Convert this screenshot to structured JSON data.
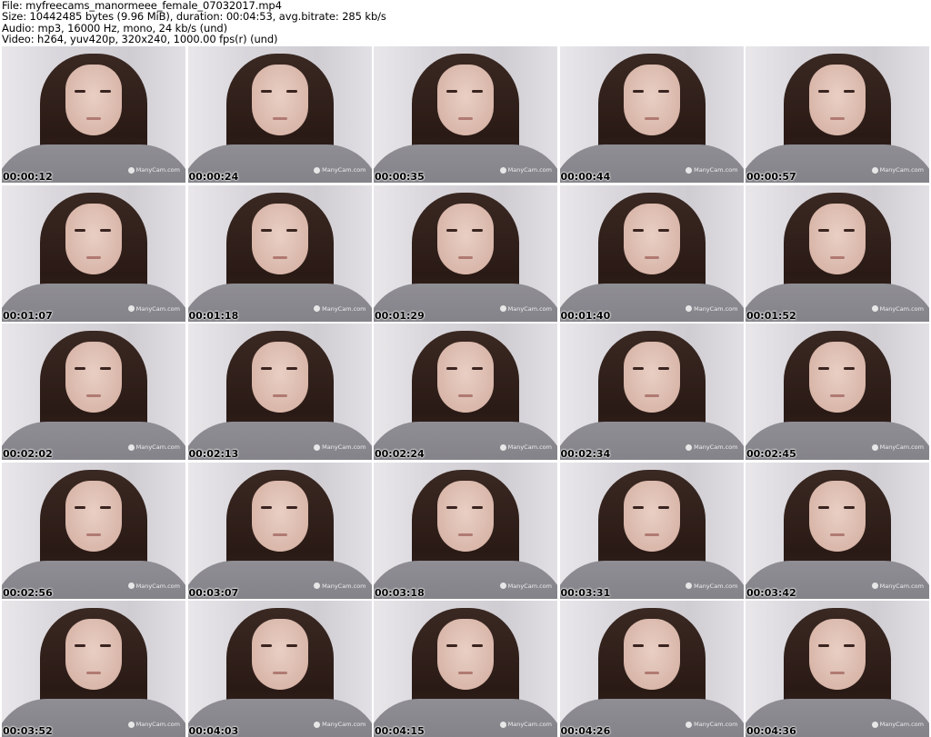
{
  "header": {
    "line1": "File: myfreecams_manormeee_female_07032017.mp4",
    "line2": "Size: 10442485 bytes (9.96 MiB), duration: 00:04:53, avg.bitrate: 285 kb/s",
    "line3": "Audio: mp3, 16000 Hz, mono, 24 kb/s (und)",
    "line4": "Video: h264, yuv420p, 320x240, 1000.00 fps(r) (und)"
  },
  "watermark": "ManyCam.com",
  "thumbnails": [
    {
      "time": "00:00:12"
    },
    {
      "time": "00:00:24"
    },
    {
      "time": "00:00:35"
    },
    {
      "time": "00:00:44"
    },
    {
      "time": "00:00:57"
    },
    {
      "time": "00:01:07"
    },
    {
      "time": "00:01:18"
    },
    {
      "time": "00:01:29"
    },
    {
      "time": "00:01:40"
    },
    {
      "time": "00:01:52"
    },
    {
      "time": "00:02:02"
    },
    {
      "time": "00:02:13"
    },
    {
      "time": "00:02:24"
    },
    {
      "time": "00:02:34"
    },
    {
      "time": "00:02:45"
    },
    {
      "time": "00:02:56"
    },
    {
      "time": "00:03:07"
    },
    {
      "time": "00:03:18"
    },
    {
      "time": "00:03:31"
    },
    {
      "time": "00:03:42"
    },
    {
      "time": "00:03:52"
    },
    {
      "time": "00:04:03"
    },
    {
      "time": "00:04:15"
    },
    {
      "time": "00:04:26"
    },
    {
      "time": "00:04:36"
    }
  ]
}
